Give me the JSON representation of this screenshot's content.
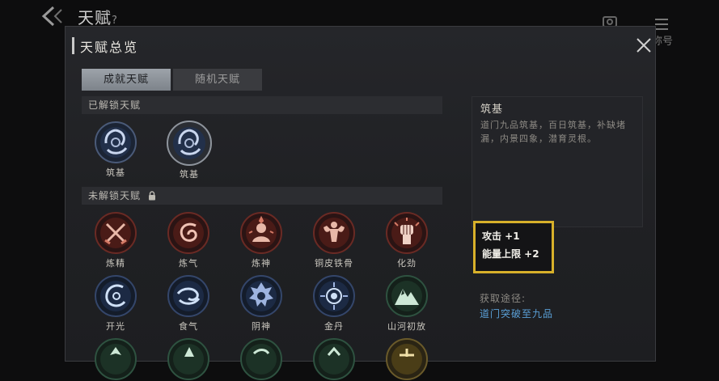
{
  "background": {
    "title": "天赋",
    "title_suffix": "?",
    "right_label": "称号"
  },
  "panel": {
    "title": "天赋总览",
    "tabs": [
      {
        "label": "成就天赋",
        "active": true
      },
      {
        "label": "随机天赋",
        "active": false
      }
    ],
    "unlocked_header": "已解锁天赋",
    "locked_header": "未解锁天赋",
    "unlocked": [
      {
        "label": "筑基",
        "icon": "swirl-ring-icon"
      },
      {
        "label": "筑基",
        "icon": "swirl-ring-icon"
      }
    ],
    "locked": [
      {
        "label": "炼精",
        "icon": "crossed-swords-icon",
        "tone": "red"
      },
      {
        "label": "炼气",
        "icon": "whirlwind-icon",
        "tone": "red"
      },
      {
        "label": "炼神",
        "icon": "meditating-figure-icon",
        "tone": "red"
      },
      {
        "label": "铜皮铁骨",
        "icon": "muscle-man-icon",
        "tone": "red"
      },
      {
        "label": "化劲",
        "icon": "raised-fist-icon",
        "tone": "red"
      },
      {
        "label": "开光",
        "icon": "crescent-spiral-icon",
        "tone": "blue"
      },
      {
        "label": "食气",
        "icon": "wind-swirl-icon",
        "tone": "blue"
      },
      {
        "label": "阴神",
        "icon": "spirit-face-icon",
        "tone": "blue"
      },
      {
        "label": "金丹",
        "icon": "golden-core-icon",
        "tone": "blue"
      },
      {
        "label": "山河初放",
        "icon": "mountain-icon",
        "tone": "green"
      }
    ]
  },
  "detail": {
    "name": "筑基",
    "description": "道门九品筑基，百日筑基，补缺堵漏，内景四象，潜育灵根。",
    "stats": [
      "攻击 +1",
      "能量上限 +2"
    ],
    "obtain_label": "获取途径:",
    "obtain_value": "道门突破至九品"
  },
  "colors": {
    "accent_gold": "#d7b02a",
    "link_blue": "#5a9fd6",
    "tab_active": "#8f959c"
  }
}
